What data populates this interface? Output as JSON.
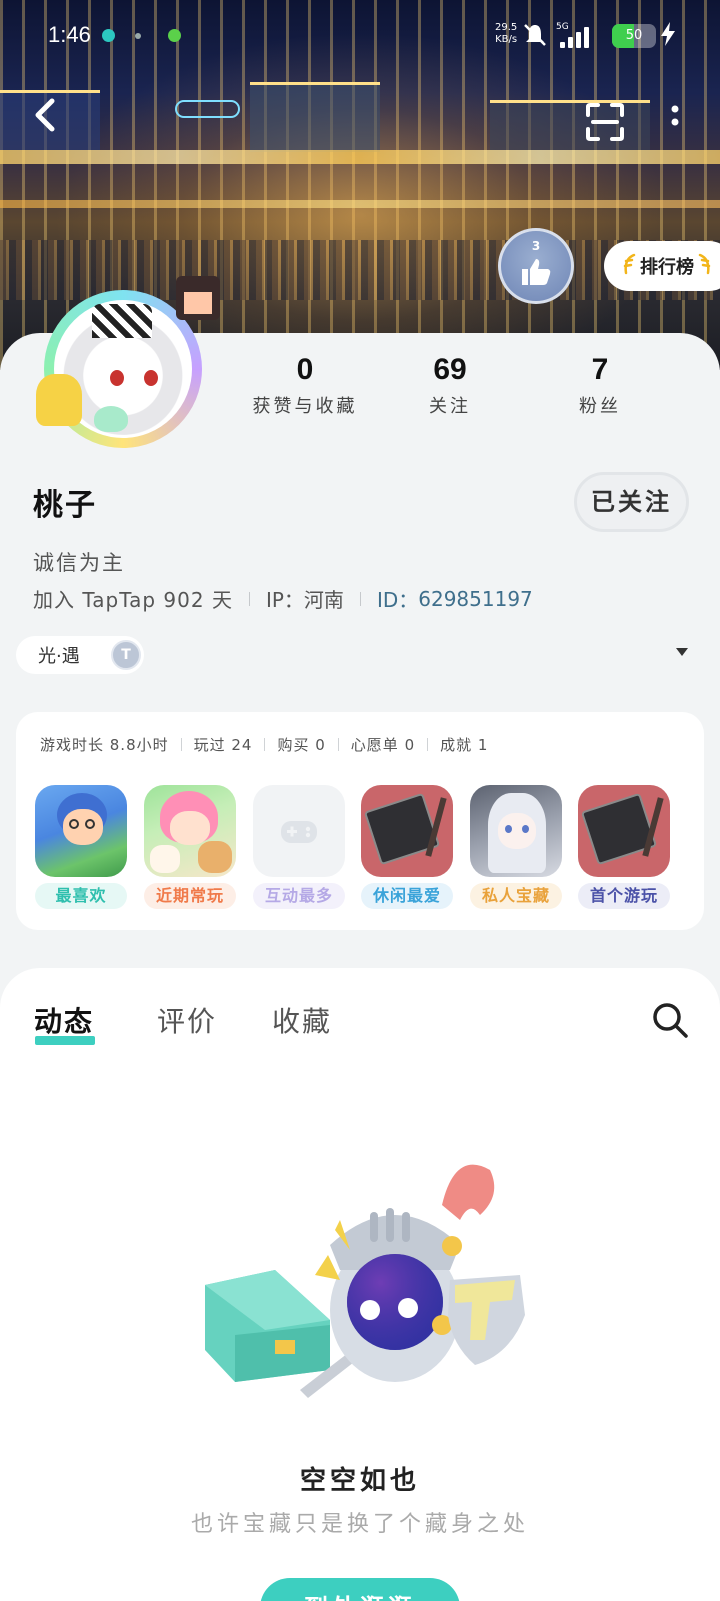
{
  "status_bar": {
    "time": "1:46",
    "net_speed_value": "29.5",
    "net_speed_unit": "KB/s",
    "network_type": "5G",
    "battery_level": "50"
  },
  "header": {
    "ranking_label": "排行榜",
    "like_badge_number": "3"
  },
  "profile": {
    "stats": [
      {
        "value": "0",
        "label": "获赞与收藏"
      },
      {
        "value": "69",
        "label": "关注"
      },
      {
        "value": "7",
        "label": "粉丝"
      }
    ],
    "name": "桃子",
    "follow_button": "已关注",
    "bio": "诚信为主",
    "join_text": "加入 TapTap 902 天",
    "ip_text": "IP：河南",
    "id_label": "ID：",
    "id_value": "629851197",
    "world_pill": "光·遇",
    "world_badge": "T"
  },
  "games": {
    "stats": [
      "游戏时长 8.8小时",
      "玩过 24",
      "购买 0",
      "心愿单 0",
      "成就 1"
    ],
    "items": [
      {
        "tag": "最喜欢",
        "tag_color": "#2fbfae",
        "tag_bg": "#e6f8f5"
      },
      {
        "tag": "近期常玩",
        "tag_color": "#f07a4a",
        "tag_bg": "#fdeee6"
      },
      {
        "tag": "互动最多",
        "tag_color": "#b5a9e6",
        "tag_bg": "#f3f1fb"
      },
      {
        "tag": "休闲最爱",
        "tag_color": "#3aa3d9",
        "tag_bg": "#e6f3fb"
      },
      {
        "tag": "私人宝藏",
        "tag_color": "#e9a23b",
        "tag_bg": "#fcf2e2"
      },
      {
        "tag": "首个游玩",
        "tag_color": "#4b52a8",
        "tag_bg": "#ecedf7"
      }
    ]
  },
  "tabs": [
    "动态",
    "评价",
    "收藏"
  ],
  "empty_state": {
    "title": "空空如也",
    "subtitle": "也许宝藏只是换了个藏身之处",
    "button_label": "到处逛逛"
  },
  "colors": {
    "accent": "#3dcfc0",
    "id_text": "#3f6f8c"
  }
}
